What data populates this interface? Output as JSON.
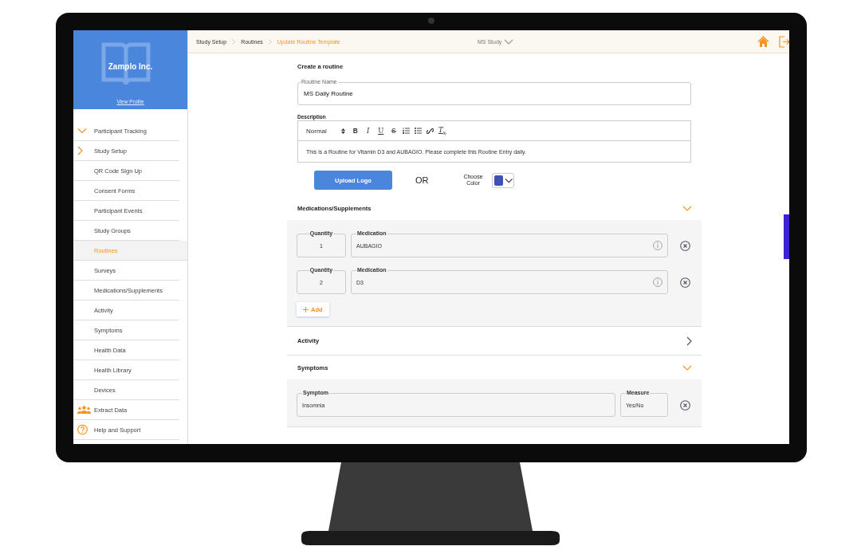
{
  "profile": {
    "name": "Zamplo Inc.",
    "link": "View Profile"
  },
  "sidebar": {
    "items": [
      {
        "label": "Participant Tracking",
        "kind": "group",
        "expanded": true,
        "selected": false
      },
      {
        "label": "Study Setup",
        "kind": "group",
        "expanded": false,
        "selected": false
      },
      {
        "label": "QR Code Sign Up",
        "kind": "plain",
        "selected": false
      },
      {
        "label": "Consent Forms",
        "kind": "plain",
        "selected": false
      },
      {
        "label": "Participant Events",
        "kind": "plain",
        "selected": false
      },
      {
        "label": "Study Groups",
        "kind": "plain",
        "selected": false
      },
      {
        "label": "Routines",
        "kind": "plain",
        "selected": true
      },
      {
        "label": "Surveys",
        "kind": "plain",
        "selected": false
      },
      {
        "label": "Medications/Supplements",
        "kind": "plain",
        "selected": false
      },
      {
        "label": "Activity",
        "kind": "plain",
        "selected": false
      },
      {
        "label": "Symptoms",
        "kind": "plain",
        "selected": false
      },
      {
        "label": "Health Data",
        "kind": "plain",
        "selected": false
      },
      {
        "label": "Health Library",
        "kind": "plain",
        "selected": false
      },
      {
        "label": "Devices",
        "kind": "plain",
        "selected": false
      },
      {
        "label": "Extract Data",
        "kind": "people",
        "selected": false
      },
      {
        "label": "Help and Support",
        "kind": "help",
        "selected": false
      }
    ]
  },
  "breadcrumbs": [
    {
      "label": "Study Setup",
      "current": false
    },
    {
      "label": "Routines",
      "current": false
    },
    {
      "label": "Update Routine Template",
      "current": true
    }
  ],
  "study_selector": "MS Study",
  "form": {
    "title": "Create a routine",
    "routine_name": {
      "label": "Routine Name",
      "value": "MS Daily Routine"
    },
    "description": {
      "label": "Description",
      "format": "Normal",
      "toolbar": [
        {
          "kind": "bold",
          "glyph": "B"
        },
        {
          "kind": "italic",
          "glyph": "I"
        },
        {
          "kind": "underline",
          "glyph": "U"
        },
        {
          "kind": "strike",
          "glyph": "S"
        },
        {
          "kind": "ordered-list"
        },
        {
          "kind": "bullet-list"
        },
        {
          "kind": "link"
        },
        {
          "kind": "clear",
          "glyph": "T$_{x}$"
        }
      ],
      "text": "This is a Routine for Vitamin D3 and AUBAGIO. Please complete this Routine Entry daily."
    },
    "upload_button": "Upload Logo",
    "or_text": "OR",
    "color_picker": {
      "label": "Choose Color",
      "color": "#3f51b5"
    }
  },
  "sections": [
    {
      "title": "Medications/Supplements",
      "kind": "medication",
      "expanded": true,
      "rows": [
        {
          "quantity_label": "Quantity",
          "quantity": "1",
          "name_label": "Medication",
          "name": "AUBAGIO"
        },
        {
          "quantity_label": "Quantity",
          "quantity": "2",
          "name_label": "Medication",
          "name": "D3"
        }
      ],
      "add_button": "Add"
    },
    {
      "title": "Activity",
      "expanded": false
    },
    {
      "title": "Symptoms",
      "kind": "symptom",
      "expanded": true,
      "rows": [
        {
          "name_label": "Symptom",
          "name": "Insomnia",
          "measure_label": "Measure",
          "measure": "Yes/No"
        }
      ]
    }
  ]
}
